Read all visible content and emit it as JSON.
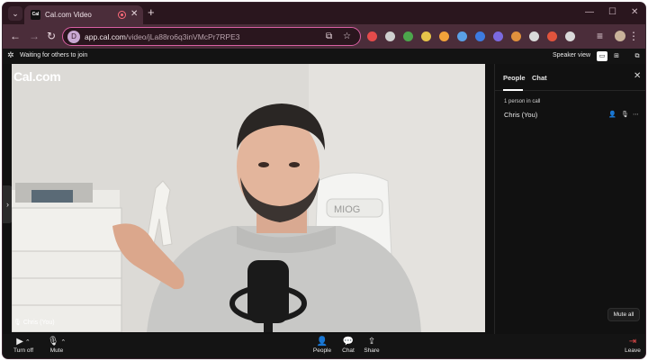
{
  "browser": {
    "tab": {
      "favicon_text": "Cal",
      "title": "Cal.com Video"
    },
    "omnibox": {
      "url_host": "app.cal.com",
      "url_path": "/video/jLa88ro6q3inVMcPr7RPE3"
    },
    "extension_colors": [
      "#e44b4b",
      "#cfcfcf",
      "#4ca64c",
      "#e6c44a",
      "#f2a33a",
      "#5aa0e6",
      "#3d7be0",
      "#7b6ae0",
      "#e0913d",
      "#d9d9d9",
      "#e0543d",
      "#d9d9d9"
    ]
  },
  "app": {
    "status_text": "Waiting for others to join",
    "view_label": "Speaker view",
    "brand": "Cal.com",
    "self_name_tag": "Chris (You)"
  },
  "panel": {
    "tabs": [
      "People",
      "Chat"
    ],
    "active_tab": "People",
    "count_text": "1 person in call",
    "participants": [
      {
        "name": "Chris (You)"
      }
    ],
    "mute_all_label": "Mute all"
  },
  "controls": {
    "camera": {
      "label": "Turn off",
      "icon": "camera-icon"
    },
    "mic": {
      "label": "Mute",
      "icon": "mic-icon"
    },
    "people": {
      "label": "People",
      "icon": "people-icon"
    },
    "chat": {
      "label": "Chat",
      "icon": "chat-icon"
    },
    "share": {
      "label": "Share",
      "icon": "share-icon"
    },
    "leave": {
      "label": "Leave",
      "icon": "leave-icon"
    }
  },
  "colors": {
    "leave": "#e34a4a",
    "accent": "#d95fa3"
  }
}
